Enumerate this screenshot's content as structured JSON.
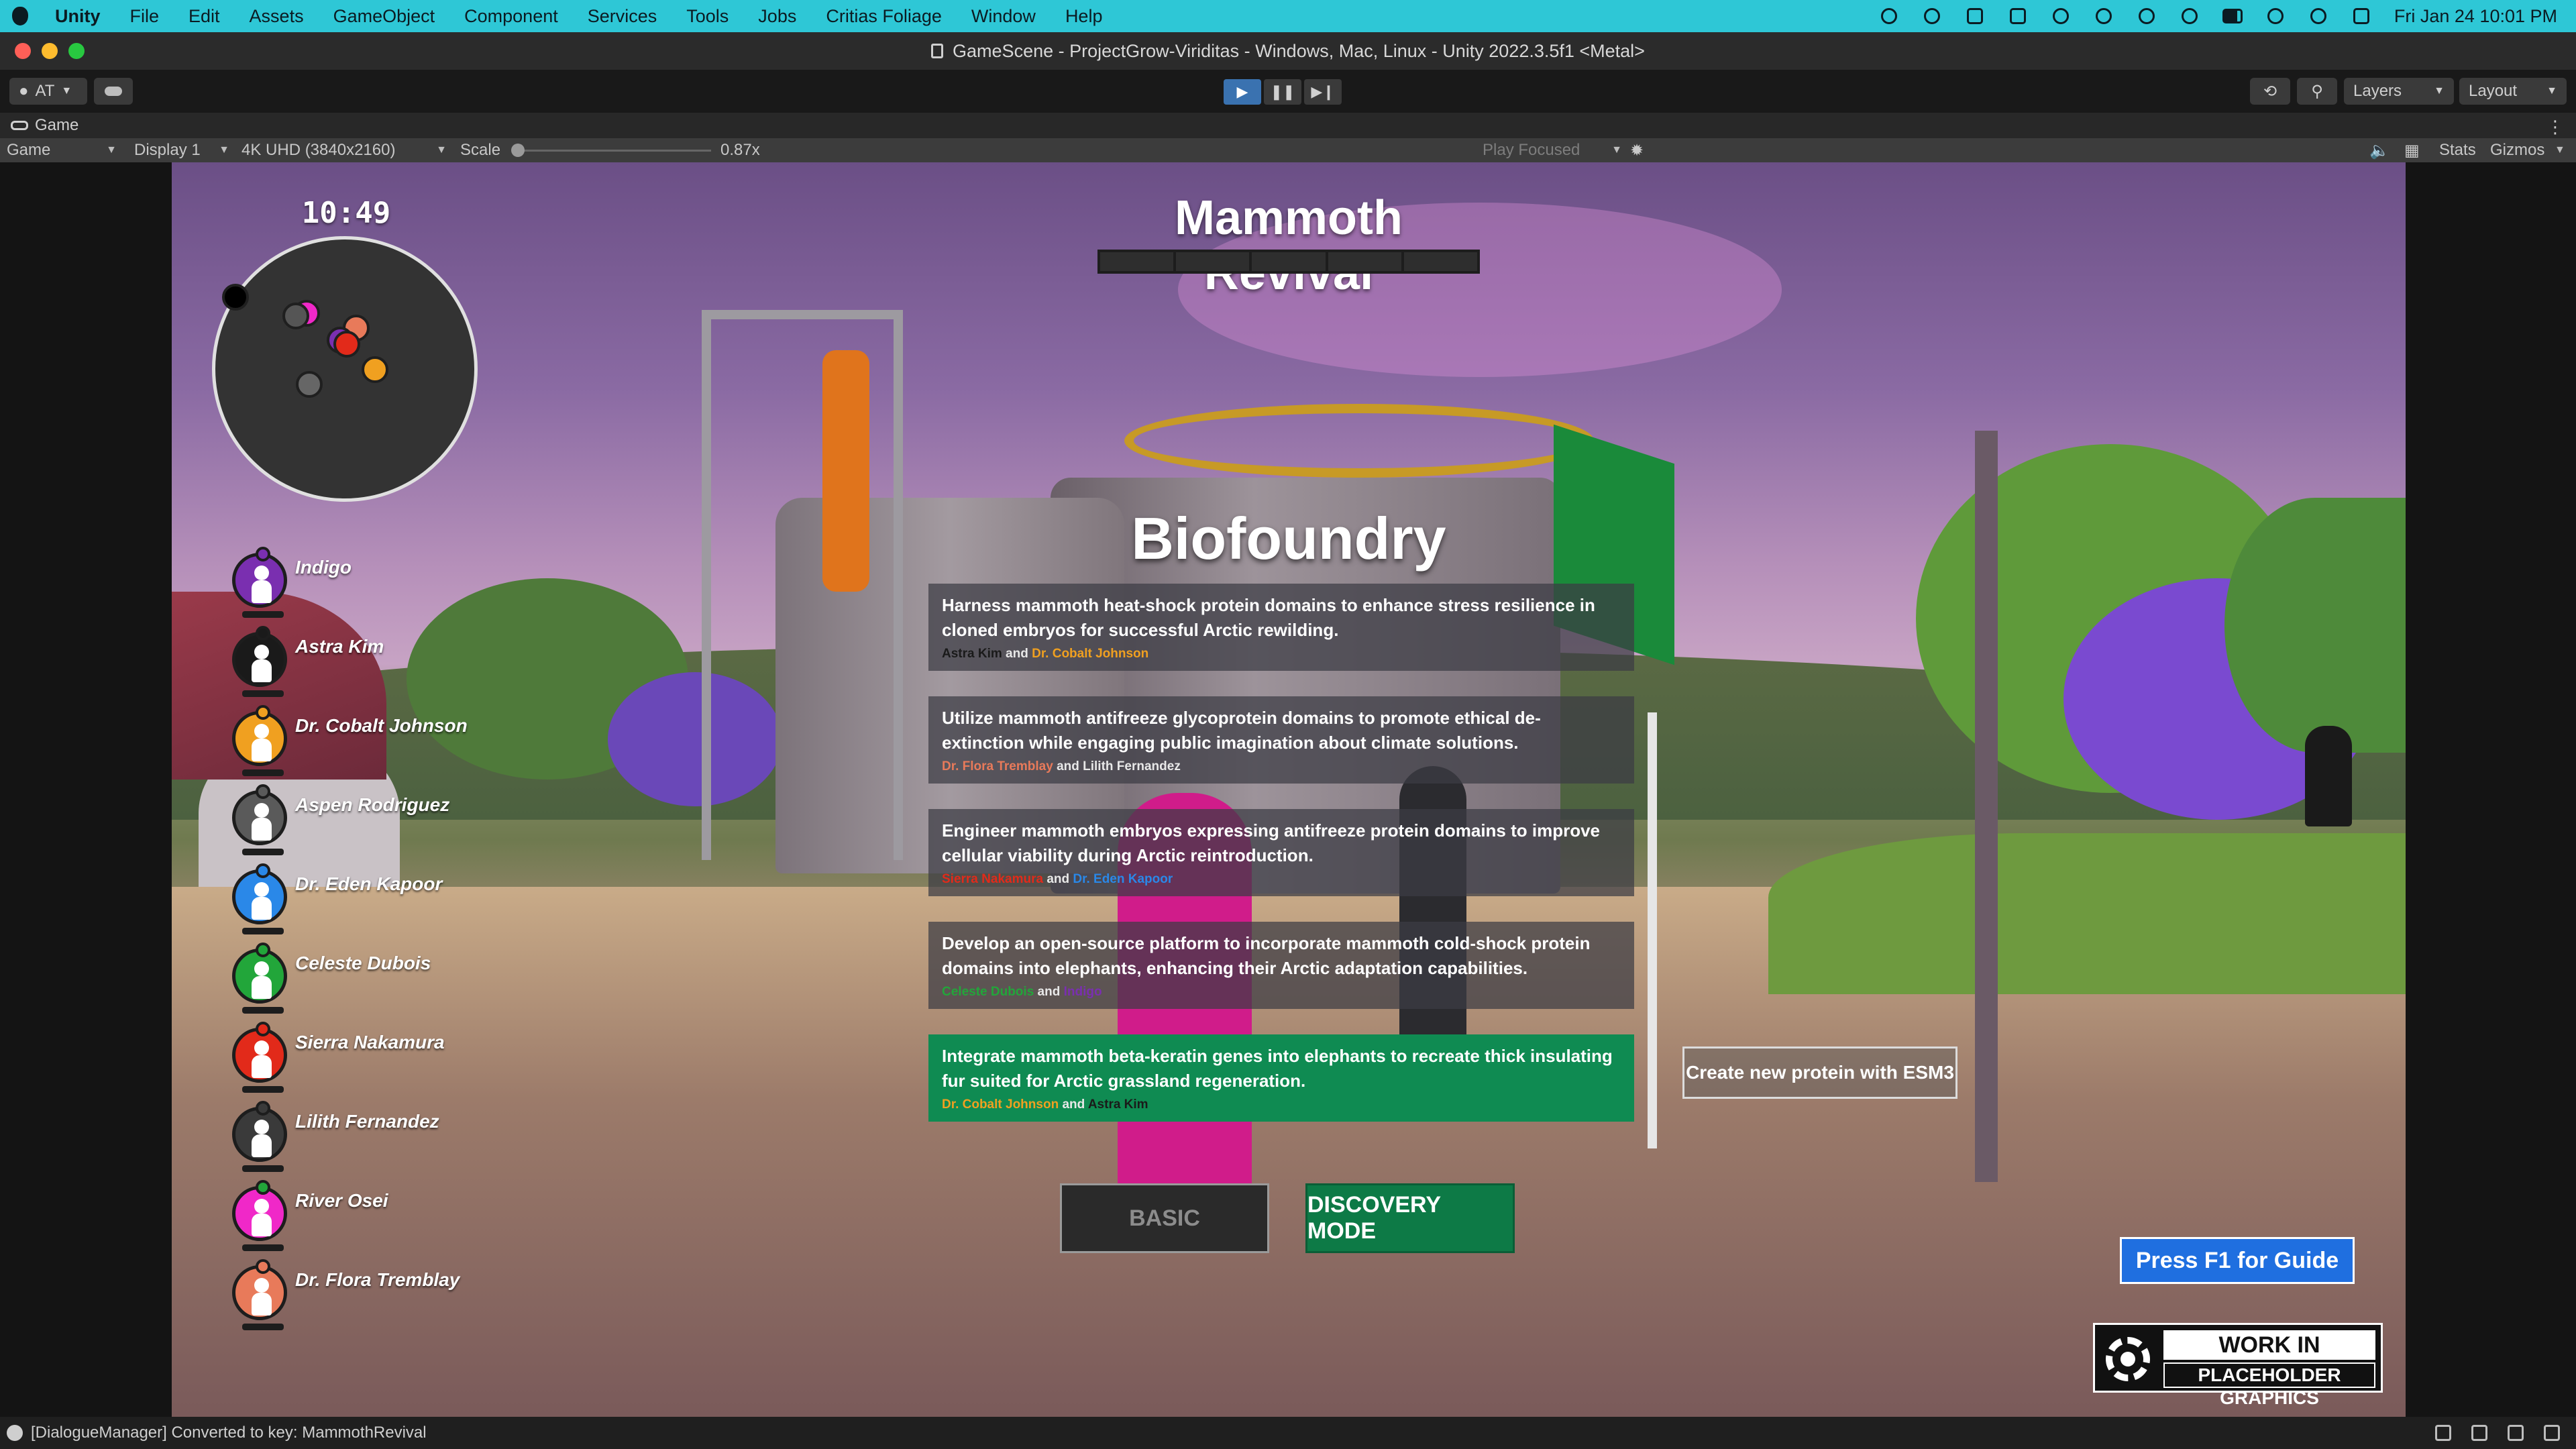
{
  "menubar": {
    "app": "Unity",
    "items": [
      "File",
      "Edit",
      "Assets",
      "GameObject",
      "Component",
      "Services",
      "Tools",
      "Jobs",
      "Critias Foliage",
      "Window",
      "Help"
    ],
    "clock": "Fri Jan 24  10:01 PM",
    "status_icons": [
      "dropbox-icon",
      "chatgpt-icon",
      "dropbox-sync-icon",
      "notion-icon",
      "wifi-icon",
      "brightness-icon",
      "bluetooth-icon",
      "play-icon",
      "battery-icon",
      "timer-icon",
      "search-icon",
      "control-center-icon"
    ]
  },
  "window": {
    "title": "GameScene - ProjectGrow-Viriditas - Windows, Mac, Linux - Unity 2022.3.5f1 <Metal>",
    "traffic_lights": [
      "#ff5f57",
      "#febc2e",
      "#28c840"
    ]
  },
  "toolbar": {
    "account_label": "AT",
    "play_icons": [
      "▶",
      "❚❚",
      "▶❙"
    ],
    "layers_label": "Layers",
    "layout_label": "Layout"
  },
  "game_tab": {
    "label": "Game"
  },
  "game_bar": {
    "view": "Game",
    "display": "Display 1",
    "resolution": "4K UHD (3840x2160)",
    "scale_label": "Scale",
    "scale_value": "0.87x",
    "scale_fraction": 0.0,
    "play_focused": "Play Focused",
    "stats": "Stats",
    "gizmos": "Gizmos"
  },
  "hud": {
    "time": "10:49",
    "quest_title": "Mammoth Revival",
    "progress_segments": 5,
    "progress_filled": 0,
    "station": "Biofoundry"
  },
  "players": [
    {
      "name": "Indigo",
      "color": "#7a2fb0"
    },
    {
      "name": "Astra Kim",
      "color": "#1a1a1a"
    },
    {
      "name": "Dr. Cobalt Johnson",
      "color": "#f0a020"
    },
    {
      "name": "Aspen Rodriguez",
      "color": "#5a5a5a"
    },
    {
      "name": "Dr. Eden Kapoor",
      "color": "#2a88e8"
    },
    {
      "name": "Celeste Dubois",
      "color": "#22a63a"
    },
    {
      "name": "Sierra Nakamura",
      "color": "#e22a1a"
    },
    {
      "name": "Lilith Fernandez",
      "color": "#3a3a3a"
    },
    {
      "name": "River Osei",
      "color": "#f028c8"
    },
    {
      "name": "Dr. Flora Tremblay",
      "color": "#e87a5a"
    }
  ],
  "options": [
    {
      "text": "Harness mammoth heat-shock protein domains to enhance stress resilience in cloned embryos for successful Arctic rewilding.",
      "author1": "Astra Kim",
      "author1_color": "#1a1a1a",
      "join": "and",
      "author2": "Dr. Cobalt Johnson",
      "author2_color": "#f0a020",
      "selected": false
    },
    {
      "text": "Utilize mammoth antifreeze glycoprotein domains to promote ethical de-extinction while engaging public imagination about climate solutions.",
      "author1": "Dr. Flora Tremblay",
      "author1_color": "#e87a5a",
      "join": "and",
      "author2": "Lilith Fernandez",
      "author2_color": "#e8e8e8",
      "selected": false
    },
    {
      "text": "Engineer mammoth embryos expressing antifreeze protein domains to improve cellular viability during Arctic reintroduction.",
      "author1": "Sierra Nakamura",
      "author1_color": "#e22a1a",
      "join": "and",
      "author2": "Dr. Eden Kapoor",
      "author2_color": "#2a88e8",
      "selected": false
    },
    {
      "text": "Develop an open-source platform to incorporate mammoth cold-shock protein domains into elephants, enhancing their Arctic adaptation capabilities.",
      "author1": "Celeste Dubois",
      "author1_color": "#22a63a",
      "join": "and",
      "author2": "Indigo",
      "author2_color": "#7a2fb0",
      "selected": false
    },
    {
      "text": "Integrate mammoth beta-keratin genes into elephants to recreate thick insulating fur suited for Arctic grassland regeneration.",
      "author1": "Dr. Cobalt Johnson",
      "author1_color": "#f0a020",
      "join": "and",
      "author2": "Astra Kim",
      "author2_color": "#1a1a1a",
      "selected": true
    }
  ],
  "buttons": {
    "esm3": "Create new protein with ESM3",
    "basic": "BASIC",
    "discovery": "DISCOVERY MODE",
    "guide": "Press F1 for Guide"
  },
  "wip": {
    "line1": "WORK IN PROGRESS",
    "line2": "PLACEHOLDER GRAPHICS"
  },
  "status": {
    "message": "[DialogueManager] Converted to key: MammothRevival"
  }
}
